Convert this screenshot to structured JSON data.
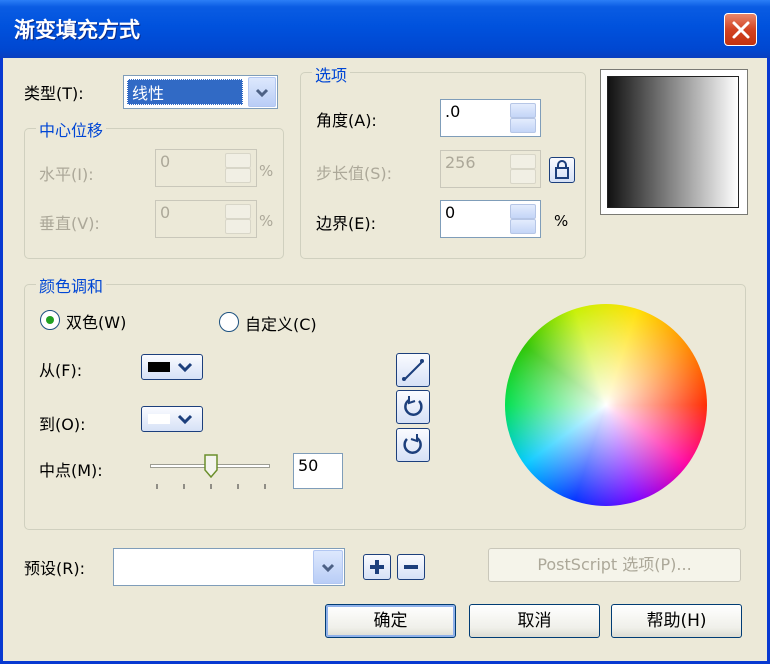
{
  "window": {
    "title": "渐变填充方式"
  },
  "type_row": {
    "label": "类型(T):",
    "value": "线性"
  },
  "center_offset": {
    "legend": "中心位移",
    "horizontal": {
      "label": "水平(I):",
      "value": "0",
      "unit": "%"
    },
    "vertical": {
      "label": "垂直(V):",
      "value": "0",
      "unit": "%"
    }
  },
  "options": {
    "legend": "选项",
    "angle": {
      "label": "角度(A):",
      "value": ".0"
    },
    "steps": {
      "label": "步长值(S):",
      "value": "256"
    },
    "edge": {
      "label": "边界(E):",
      "value": "0",
      "unit": "%"
    }
  },
  "preview": {
    "colors": [
      "#111111",
      "#ffffff"
    ]
  },
  "color_blend": {
    "legend": "颜色调和",
    "two_color": {
      "label": "双色(W)",
      "selected": true
    },
    "custom": {
      "label": "自定义(C)",
      "selected": false
    },
    "from": {
      "label": "从(F):",
      "color": "#000000"
    },
    "to": {
      "label": "到(O):",
      "color": "#ffffff"
    },
    "midpoint": {
      "label": "中点(M):",
      "value": "50",
      "fraction": 0.5
    }
  },
  "presets": {
    "label": "预设(R):",
    "value": ""
  },
  "buttons": {
    "postscript": "PostScript 选项(P)...",
    "ok": "确定",
    "cancel": "取消",
    "help": "帮助(H)"
  }
}
